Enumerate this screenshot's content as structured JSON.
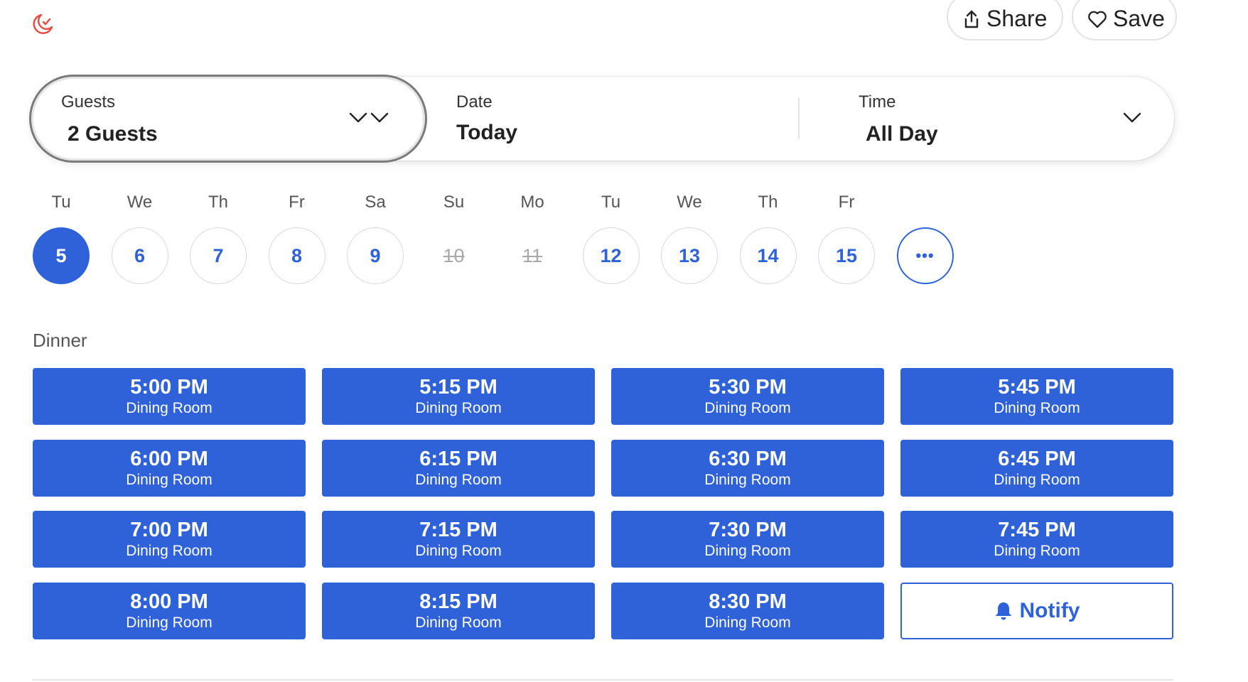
{
  "header": {
    "share_label": "Share",
    "save_label": "Save",
    "icons": {
      "moon": "moon-check-icon",
      "share": "share-icon",
      "save": "heart-icon"
    },
    "accent_color": "#e8493f"
  },
  "search": {
    "guests": {
      "label": "Guests",
      "value": "2 Guests"
    },
    "date": {
      "label": "Date",
      "value": "Today"
    },
    "time": {
      "label": "Time",
      "value": "All Day"
    }
  },
  "days": [
    {
      "name": "Tu",
      "number": "5",
      "state": "selected"
    },
    {
      "name": "We",
      "number": "6",
      "state": "available"
    },
    {
      "name": "Th",
      "number": "7",
      "state": "available"
    },
    {
      "name": "Fr",
      "number": "8",
      "state": "available"
    },
    {
      "name": "Sa",
      "number": "9",
      "state": "available"
    },
    {
      "name": "Su",
      "number": "10",
      "state": "disabled"
    },
    {
      "name": "Mo",
      "number": "11",
      "state": "disabled"
    },
    {
      "name": "Tu",
      "number": "12",
      "state": "available"
    },
    {
      "name": "We",
      "number": "13",
      "state": "available"
    },
    {
      "name": "Th",
      "number": "14",
      "state": "available"
    },
    {
      "name": "Fr",
      "number": "15",
      "state": "available"
    },
    {
      "name": "",
      "number": "•••",
      "state": "more"
    }
  ],
  "section": {
    "title": "Dinner"
  },
  "slots": [
    {
      "time": "5:00 PM",
      "room": "Dining Room"
    },
    {
      "time": "5:15 PM",
      "room": "Dining Room"
    },
    {
      "time": "5:30 PM",
      "room": "Dining Room"
    },
    {
      "time": "5:45 PM",
      "room": "Dining Room"
    },
    {
      "time": "6:00 PM",
      "room": "Dining Room"
    },
    {
      "time": "6:15 PM",
      "room": "Dining Room"
    },
    {
      "time": "6:30 PM",
      "room": "Dining Room"
    },
    {
      "time": "6:45 PM",
      "room": "Dining Room"
    },
    {
      "time": "7:00 PM",
      "room": "Dining Room"
    },
    {
      "time": "7:15 PM",
      "room": "Dining Room"
    },
    {
      "time": "7:30 PM",
      "room": "Dining Room"
    },
    {
      "time": "7:45 PM",
      "room": "Dining Room"
    },
    {
      "time": "8:00 PM",
      "room": "Dining Room"
    },
    {
      "time": "8:15 PM",
      "room": "Dining Room"
    },
    {
      "time": "8:30 PM",
      "room": "Dining Room"
    }
  ],
  "notify": {
    "label": "Notify",
    "icon": "bell-icon"
  },
  "colors": {
    "primary": "#2f62d8",
    "disabled": "#a9a9a9"
  }
}
